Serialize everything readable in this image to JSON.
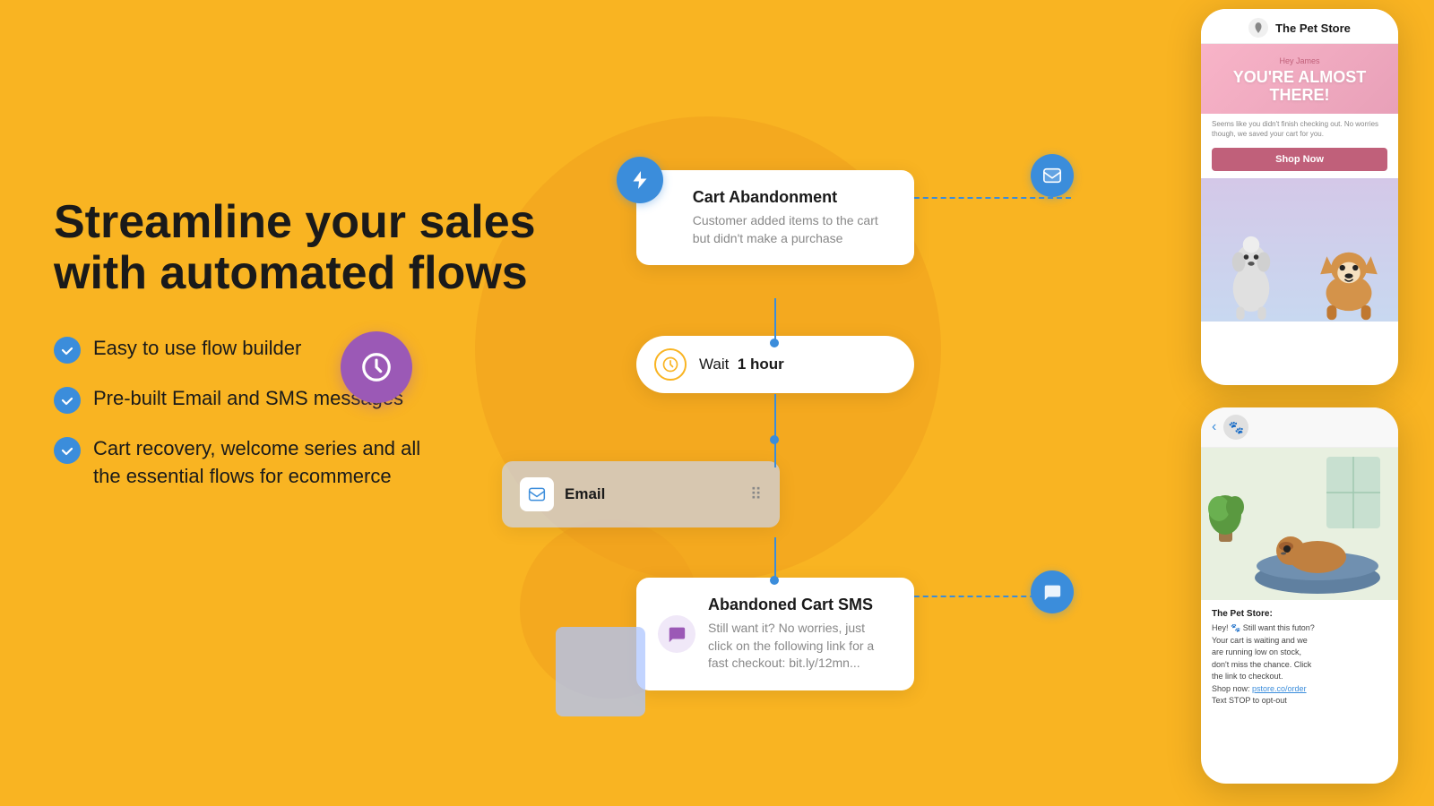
{
  "background_color": "#F9B422",
  "headline": "Streamline your sales\nwith automated flows",
  "features": [
    {
      "id": "f1",
      "text": "Easy to use flow builder"
    },
    {
      "id": "f2",
      "text": "Pre-built Email and SMS messages"
    },
    {
      "id": "f3",
      "text": "Cart recovery, welcome series and all\nthe essential flows for ecommerce"
    }
  ],
  "flow": {
    "cart_abandonment": {
      "title": "Cart Abandonment",
      "description": "Customer added items to the cart but didn't make a purchase"
    },
    "wait": {
      "label": "Wait",
      "duration": "1 hour"
    },
    "email": {
      "label": "Email"
    },
    "sms": {
      "title": "Abandoned Cart SMS",
      "description": "Still want it? No worries, just click on the following link for a fast checkout: bit.ly/12mn..."
    }
  },
  "phone_top": {
    "store_name": "The Pet Store",
    "email_small": "Hey James",
    "email_heading": "YOU'RE ALMOST\nTHERE!",
    "email_body": "Seems like you didn't finish checking out. No worries though, we saved your cart for you.",
    "shop_btn": "Shop Now"
  },
  "phone_bottom": {
    "sender": "The Pet Store:",
    "message": "Hey! 🐾 Still want this futon?\nYour cart is waiting and we\nare running low on stock,\ndon't miss the chance. Click\nthe link to checkout.\nShop now: pstore.co/order\nText STOP to opt-out"
  }
}
